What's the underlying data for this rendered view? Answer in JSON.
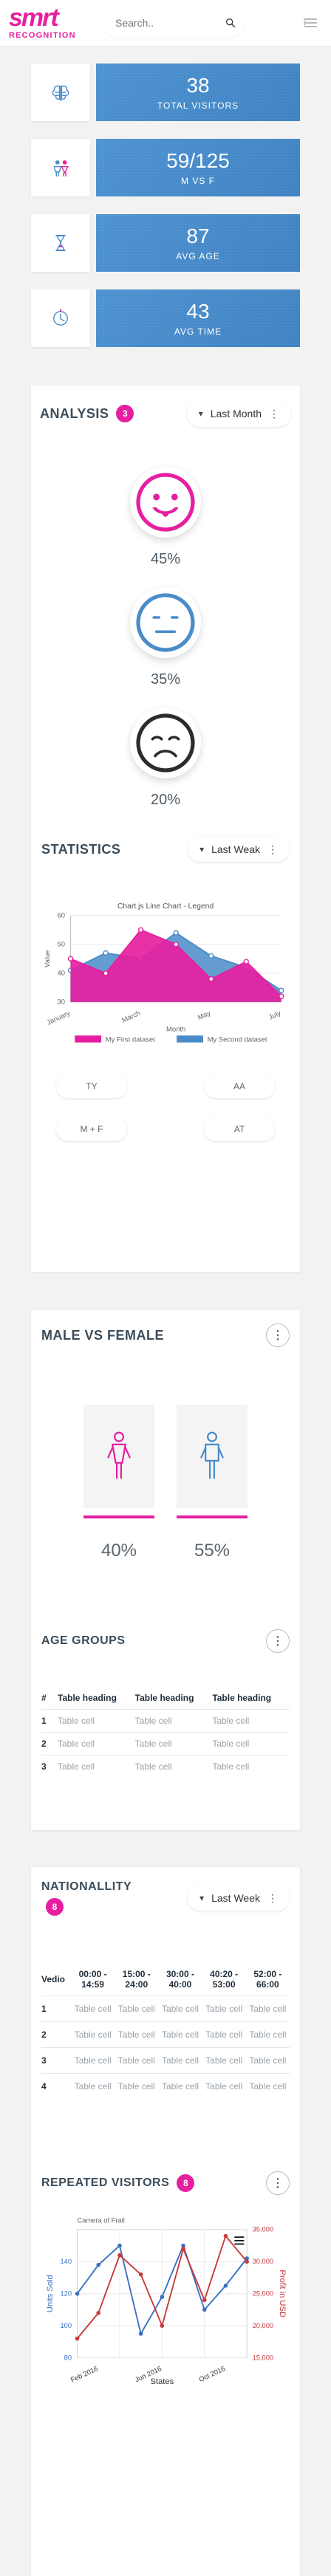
{
  "header": {
    "logo_top": "smrt",
    "logo_bottom": "RECOGNITION",
    "search_placeholder": "Search..",
    "icons": {
      "search": "search-icon",
      "menu": "menu-collapse-icon"
    }
  },
  "stats": [
    {
      "icon": "brain-icon",
      "value": "38",
      "label": "TOTAL VISITORS"
    },
    {
      "icon": "gender-icon",
      "value": "59/125",
      "label": "M VS F"
    },
    {
      "icon": "hourglass-icon",
      "value": "87",
      "label": "AVG AGE"
    },
    {
      "icon": "clock-icon",
      "value": "43",
      "label": "AVG TIME"
    }
  ],
  "analysis": {
    "title": "ANALYSIS",
    "badge": "3",
    "dropdown_label": "Last Month",
    "moods": [
      {
        "name": "happy",
        "percent": "45%",
        "color": "#e61fa0"
      },
      {
        "name": "neutral",
        "percent": "35%",
        "color": "#4a8cc8"
      },
      {
        "name": "sad",
        "percent": "20%",
        "color": "#2c2c2c"
      }
    ]
  },
  "statistics": {
    "title": "STATISTICS",
    "dropdown_label": "Last Weak",
    "buttons": [
      "TY",
      "AA",
      "M + F",
      "AT"
    ],
    "chart_data": {
      "type": "area",
      "title": "Chart.js Line Chart - Legend",
      "xlabel": "Month",
      "ylabel": "Value",
      "categories": [
        "January",
        "March",
        "May",
        "July"
      ],
      "ylim": [
        30,
        60
      ],
      "series": [
        {
          "name": "My First dataset",
          "color": "#e61fa0",
          "values": [
            45,
            40,
            55,
            50,
            38,
            44,
            32
          ]
        },
        {
          "name": "My Second dataset",
          "color": "#4a8cc8",
          "values": [
            41,
            47,
            45,
            54,
            46,
            42,
            34
          ]
        }
      ],
      "yticks": [
        "30",
        "40",
        "50",
        "60"
      ],
      "xticks": [
        "January",
        "March",
        "May",
        "July"
      ],
      "legend": [
        {
          "label": "My First dataset",
          "color": "#e61fa0"
        },
        {
          "label": "My Second dataset",
          "color": "#4a8cc8"
        }
      ]
    }
  },
  "male_vs_female": {
    "title": "MALE VS FEMALE",
    "female_percent": "40%",
    "male_percent": "55%"
  },
  "age_groups": {
    "title": "AGE GROUPS",
    "headers": [
      "#",
      "Table heading",
      "Table heading",
      "Table heading"
    ],
    "rows": [
      [
        "1",
        "Table cell",
        "Table cell",
        "Table cell"
      ],
      [
        "2",
        "Table cell",
        "Table cell",
        "Table cell"
      ],
      [
        "3",
        "Table cell",
        "Table cell",
        "Table cell"
      ]
    ]
  },
  "nationality": {
    "title": "NATIONALLITY",
    "badge": "8",
    "dropdown_label": "Last Week",
    "headers": [
      "Vedio",
      "00:00 - 14:59",
      "15:00 - 24:00",
      "30:00 - 40:00",
      "40:20 - 53:00",
      "52:00 - 66:00"
    ],
    "rows": [
      [
        "1",
        "Table cell",
        "Table cell",
        "Table cell",
        "Table cell",
        "Table cell"
      ],
      [
        "2",
        "Table cell",
        "Table cell",
        "Table cell",
        "Table cell",
        "Table cell"
      ],
      [
        "3",
        "Table cell",
        "Table cell",
        "Table cell",
        "Table cell",
        "Table cell"
      ],
      [
        "4",
        "Table cell",
        "Table cell",
        "Table cell",
        "Table cell",
        "Table cell"
      ]
    ]
  },
  "repeated_visitors": {
    "title": "REPEATED VISITORS",
    "badge": "8",
    "chart_data": {
      "type": "line",
      "title": "Camera of Frail",
      "xlabel": "States",
      "ylabel_left": "Units Sold",
      "ylabel_right": "Profit in USD",
      "x": [
        "Feb 2016",
        "Jun 2016",
        "Oct 2016"
      ],
      "left_ylim": [
        80,
        160
      ],
      "right_ylim": [
        15000,
        35000
      ],
      "left_yticks": [
        "80",
        "100",
        "120",
        "140"
      ],
      "right_yticks": [
        "15,000",
        "20,000",
        "25,000",
        "30,000",
        "35,000"
      ],
      "series": [
        {
          "name": "",
          "color": "#3b6fc1",
          "values": [
            120,
            138,
            150,
            95,
            118,
            150,
            110,
            125,
            142
          ]
        },
        {
          "name": "",
          "color": "#c73a3a",
          "values": [
            18000,
            22000,
            31000,
            28000,
            20000,
            32000,
            24000,
            34000,
            30000
          ]
        }
      ]
    }
  }
}
